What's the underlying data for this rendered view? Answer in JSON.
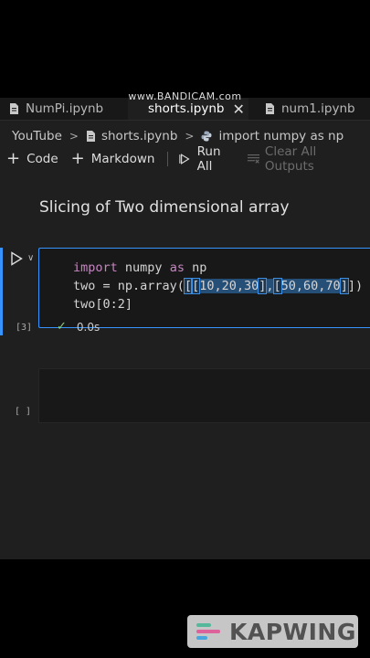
{
  "watermark": "www.BANDICAM.com",
  "tabs": [
    {
      "label": "NumPi.ipynb",
      "active": false
    },
    {
      "label": "shorts.ipynb",
      "active": true
    },
    {
      "label": "num1.ipynb",
      "active": false
    }
  ],
  "breadcrumb": {
    "root": "YouTube",
    "file": "shorts.ipynb",
    "symbol": "import numpy as np"
  },
  "toolbar": {
    "code": "Code",
    "markdown": "Markdown",
    "run_all": "Run All",
    "clear_all": "Clear All Outputs"
  },
  "markdown_cell": {
    "text": "Slicing of Two dimensional array"
  },
  "code_cell": {
    "execution_count": "[3]",
    "line1": {
      "kw1": "import",
      "mod": " numpy ",
      "kw2": "as",
      "alias": " np"
    },
    "line2": {
      "pre": "two = np.array(",
      "b0": "[",
      "b1": "[",
      "row1": "10,20,30",
      "b2": "]",
      "comma": ",",
      "b3": "[",
      "row2": "50,60,70",
      "b4": "]",
      "b5": "]",
      "close": ")"
    },
    "line3": "two[0:2]",
    "status_time": "0.0s"
  },
  "empty_cell": {
    "execution_count": "[ ]"
  },
  "kapwing": "KAPWING",
  "colors": {
    "accent": "#3794ff",
    "background": "#1f1f1f",
    "keyword": "#c586c0",
    "success": "#89d185"
  }
}
